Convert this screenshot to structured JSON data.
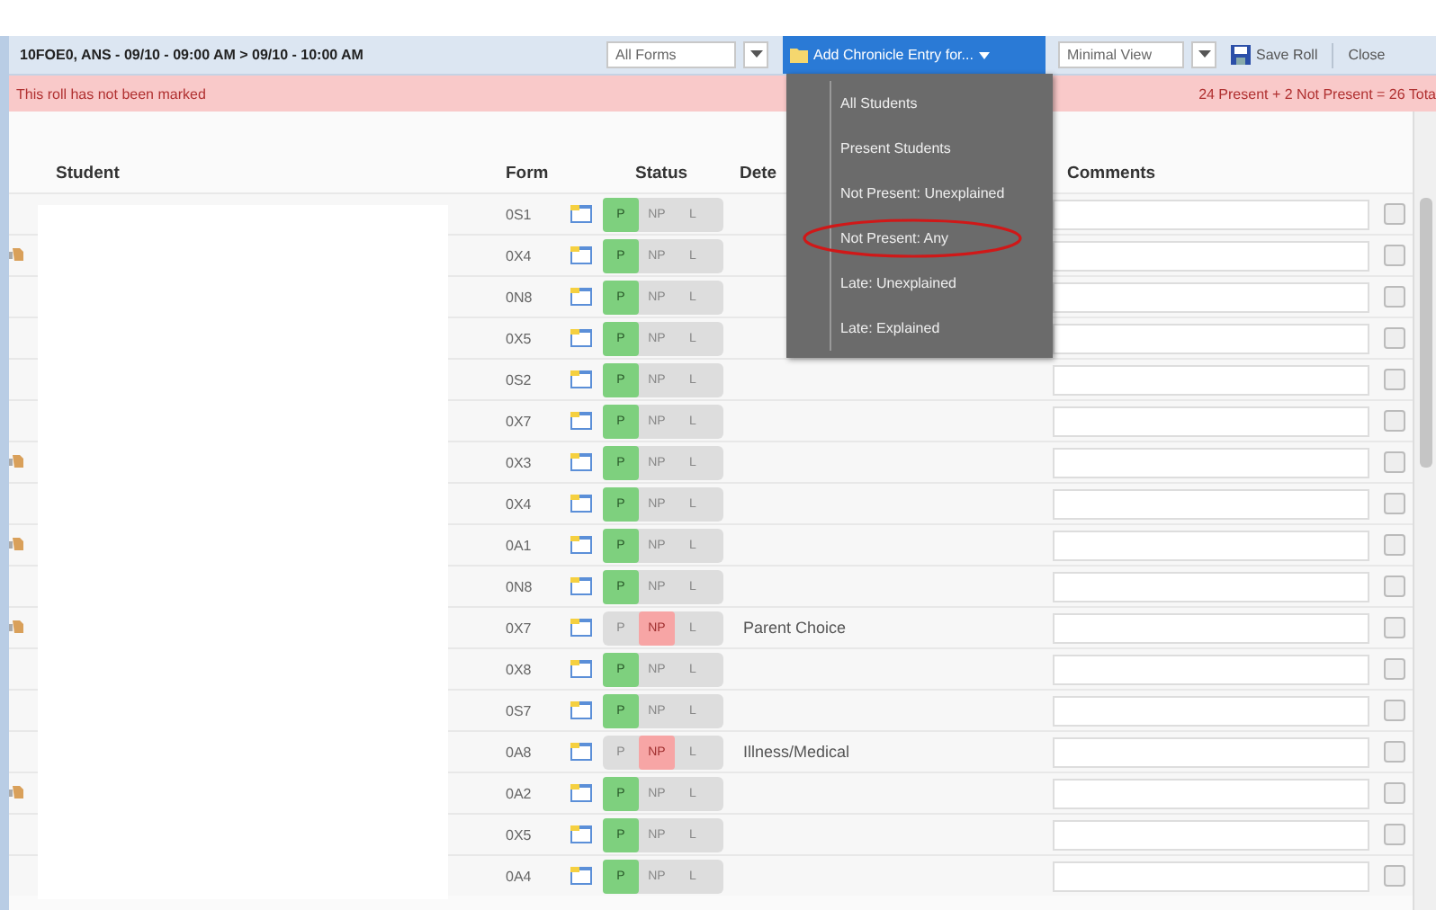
{
  "toolbar": {
    "title": "10FOE0, ANS - 09/10 - 09:00 AM > 09/10 - 10:00 AM",
    "form_filter": "All Forms",
    "chronicle_button": "Add Chronicle Entry for...",
    "view_select": "Minimal View",
    "save_button": "Save Roll",
    "close_button": "Close"
  },
  "status_bar": {
    "message": "This roll has not been marked",
    "totals": "24 Present + 2 Not Present = 26 Tota"
  },
  "table": {
    "columns": [
      "Student",
      "Form",
      "Status",
      "Dete",
      "Comments"
    ],
    "rows": [
      {
        "flagged": false,
        "form": "0S1",
        "options": [
          {
            "label": "P",
            "selected": true
          },
          {
            "label": "NP",
            "selected": false
          },
          {
            "label": "L",
            "selected": false
          }
        ],
        "checked": false
      },
      {
        "flagged": true,
        "form": "0X4",
        "options": [
          {
            "label": "P",
            "selected": true
          },
          {
            "label": "NP",
            "selected": false
          },
          {
            "label": "L",
            "selected": false
          }
        ],
        "checked": false
      },
      {
        "flagged": false,
        "form": "0N8",
        "options": [
          {
            "label": "P",
            "selected": true
          },
          {
            "label": "NP",
            "selected": false
          },
          {
            "label": "L",
            "selected": false
          }
        ],
        "checked": false
      },
      {
        "flagged": false,
        "form": "0X5",
        "options": [
          {
            "label": "P",
            "selected": true
          },
          {
            "label": "NP",
            "selected": false
          },
          {
            "label": "L",
            "selected": false
          }
        ],
        "checked": false
      },
      {
        "flagged": false,
        "form": "0S2",
        "options": [
          {
            "label": "P",
            "selected": true
          },
          {
            "label": "NP",
            "selected": false
          },
          {
            "label": "L",
            "selected": false
          }
        ],
        "checked": false
      },
      {
        "flagged": false,
        "form": "0X7",
        "options": [
          {
            "label": "P",
            "selected": true
          },
          {
            "label": "NP",
            "selected": false
          },
          {
            "label": "L",
            "selected": false
          }
        ],
        "checked": false
      },
      {
        "flagged": true,
        "form": "0X3",
        "options": [
          {
            "label": "P",
            "selected": true
          },
          {
            "label": "NP",
            "selected": false
          },
          {
            "label": "L",
            "selected": false
          }
        ],
        "checked": false
      },
      {
        "flagged": false,
        "form": "0X4",
        "options": [
          {
            "label": "P",
            "selected": true
          },
          {
            "label": "NP",
            "selected": false
          },
          {
            "label": "L",
            "selected": false
          }
        ],
        "checked": false
      },
      {
        "flagged": true,
        "form": "0A1",
        "options": [
          {
            "label": "P",
            "selected": true
          },
          {
            "label": "NP",
            "selected": false
          },
          {
            "label": "L",
            "selected": false
          }
        ],
        "checked": false
      },
      {
        "flagged": false,
        "form": "0N8",
        "options": [
          {
            "label": "P",
            "selected": true
          },
          {
            "label": "NP",
            "selected": false
          },
          {
            "label": "L",
            "selected": false
          }
        ],
        "checked": false
      },
      {
        "flagged": true,
        "form": "0X7",
        "options": [
          {
            "label": "P",
            "selected": false
          },
          {
            "label": "NP",
            "selected": true
          },
          {
            "label": "L",
            "selected": false
          }
        ],
        "detail": "Parent Choice",
        "checked": false
      },
      {
        "flagged": false,
        "form": "0X8",
        "options": [
          {
            "label": "P",
            "selected": true
          },
          {
            "label": "NP",
            "selected": false
          },
          {
            "label": "L",
            "selected": false
          }
        ],
        "checked": false
      },
      {
        "flagged": false,
        "form": "0S7",
        "options": [
          {
            "label": "P",
            "selected": true
          },
          {
            "label": "NP",
            "selected": false
          },
          {
            "label": "L",
            "selected": false
          }
        ],
        "checked": false
      },
      {
        "flagged": false,
        "form": "0A8",
        "options": [
          {
            "label": "P",
            "selected": false
          },
          {
            "label": "NP",
            "selected": true
          },
          {
            "label": "L",
            "selected": false
          }
        ],
        "detail": "Illness/Medical",
        "checked": false
      },
      {
        "flagged": true,
        "form": "0A2",
        "options": [
          {
            "label": "P",
            "selected": true
          },
          {
            "label": "NP",
            "selected": false
          },
          {
            "label": "L",
            "selected": false
          }
        ],
        "checked": false
      },
      {
        "flagged": false,
        "form": "0X5",
        "options": [
          {
            "label": "P",
            "selected": true
          },
          {
            "label": "NP",
            "selected": false
          },
          {
            "label": "L",
            "selected": false
          }
        ],
        "checked": false
      },
      {
        "flagged": false,
        "form": "0A4",
        "options": [
          {
            "label": "P",
            "selected": true
          },
          {
            "label": "NP",
            "selected": false
          },
          {
            "label": "L",
            "selected": false
          }
        ],
        "checked": false
      }
    ]
  },
  "menu": {
    "items": [
      {
        "label": "All Students",
        "circled": false
      },
      {
        "label": "Present Students",
        "circled": false
      },
      {
        "label": "Not Present: Unexplained",
        "circled": false
      },
      {
        "label": "Not Present: Any",
        "circled": true
      },
      {
        "label": "Late: Unexplained",
        "circled": false
      },
      {
        "label": "Late: Explained",
        "circled": false
      }
    ]
  }
}
